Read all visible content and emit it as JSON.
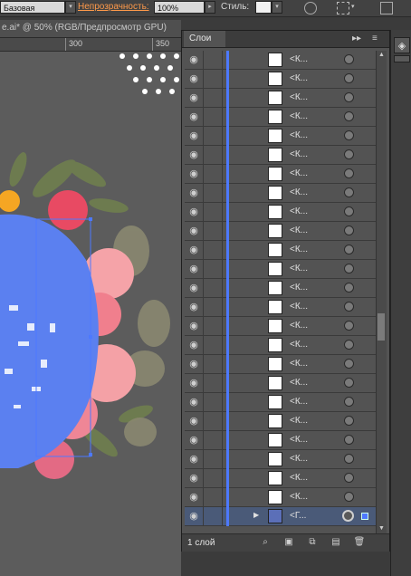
{
  "control_bar": {
    "brush_value": "Базовая",
    "opacity_label": "Непрозрачность:",
    "opacity_value": "100%",
    "style_label": "Стиль:"
  },
  "document": {
    "tab_title": "e.ai* @ 50% (RGB/Предпросмотр GPU)",
    "ruler_marks": [
      "300",
      "350"
    ]
  },
  "layers_panel": {
    "title": "Слои",
    "collapse_icon": "double-arrow-icon",
    "menu_icon": "panel-menu-icon",
    "rows": [
      {
        "name": "<К..."
      },
      {
        "name": "<К..."
      },
      {
        "name": "<К..."
      },
      {
        "name": "<К..."
      },
      {
        "name": "<К..."
      },
      {
        "name": "<К..."
      },
      {
        "name": "<К..."
      },
      {
        "name": "<К..."
      },
      {
        "name": "<К..."
      },
      {
        "name": "<К..."
      },
      {
        "name": "<К..."
      },
      {
        "name": "<К..."
      },
      {
        "name": "<К..."
      },
      {
        "name": "<К..."
      },
      {
        "name": "<К..."
      },
      {
        "name": "<К..."
      },
      {
        "name": "<К..."
      },
      {
        "name": "<К..."
      },
      {
        "name": "<К..."
      },
      {
        "name": "<К..."
      },
      {
        "name": "<К..."
      },
      {
        "name": "<К..."
      },
      {
        "name": "<К..."
      },
      {
        "name": "<К..."
      }
    ],
    "last_row_name": "<Г...",
    "footer_count": "1 слой"
  },
  "colors": {
    "accent_blue": "#4d79ff",
    "panel_bg": "#535353",
    "opacity_label_color": "#ff9a4a"
  }
}
